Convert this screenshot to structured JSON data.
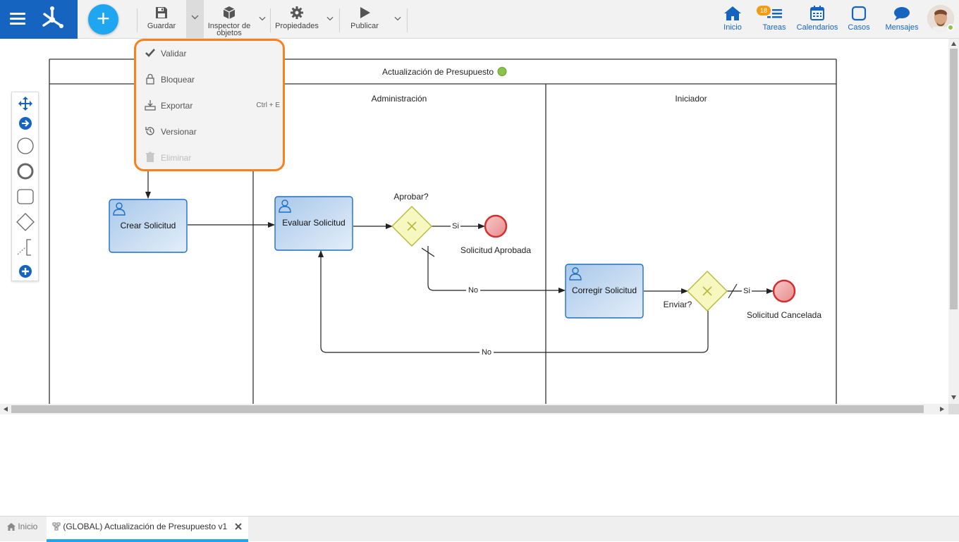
{
  "toolbar": {
    "save_label": "Guardar",
    "inspector_label_line1": "Inspector de",
    "inspector_label_line2": "objetos",
    "properties_label": "Propiedades",
    "publish_label": "Publicar"
  },
  "nav": {
    "home_label": "Inicio",
    "tasks_label": "Tareas",
    "tasks_badge": "18",
    "calendars_label": "Calendarios",
    "cases_label": "Casos",
    "messages_label": "Mensajes"
  },
  "menu": {
    "items": [
      {
        "label": "Validar",
        "shortcut": "",
        "enabled": true,
        "icon": "check-icon"
      },
      {
        "label": "Bloquear",
        "shortcut": "",
        "enabled": true,
        "icon": "lock-icon"
      },
      {
        "label": "Exportar",
        "shortcut": "Ctrl + E",
        "enabled": true,
        "icon": "export-icon"
      },
      {
        "label": "Versionar",
        "shortcut": "",
        "enabled": true,
        "icon": "history-icon"
      },
      {
        "label": "Eliminar",
        "shortcut": "",
        "enabled": false,
        "icon": "trash-icon"
      }
    ]
  },
  "diagram": {
    "pool_title": "Actualización de Presupuesto",
    "lanes": [
      "Administración",
      "Iniciador"
    ],
    "tasks": {
      "create": "Crear Solicitud",
      "evaluate": "Evaluar Solicitud",
      "correct": "Corregir Solicitud"
    },
    "gateways": {
      "approve": "Aprobar?",
      "send": "Enviar?"
    },
    "events": {
      "approved": "Solicitud Aprobada",
      "cancelled": "Solicitud Cancelada"
    },
    "flows": {
      "yes1": "Si",
      "no1": "No",
      "yes2": "Si",
      "no2": "No"
    }
  },
  "tabs": {
    "home_label": "Inicio",
    "process_label": "(GLOBAL) Actualización de Presupuesto v1"
  },
  "colors": {
    "brand": "#1565c0",
    "accent": "#1ea7f0",
    "highlight": "#f5821f",
    "task_fill": "#c5dcf2",
    "gateway_fill": "#f7f7c0",
    "end_event": "#f4b6b6",
    "status_green": "#8bc34a"
  }
}
